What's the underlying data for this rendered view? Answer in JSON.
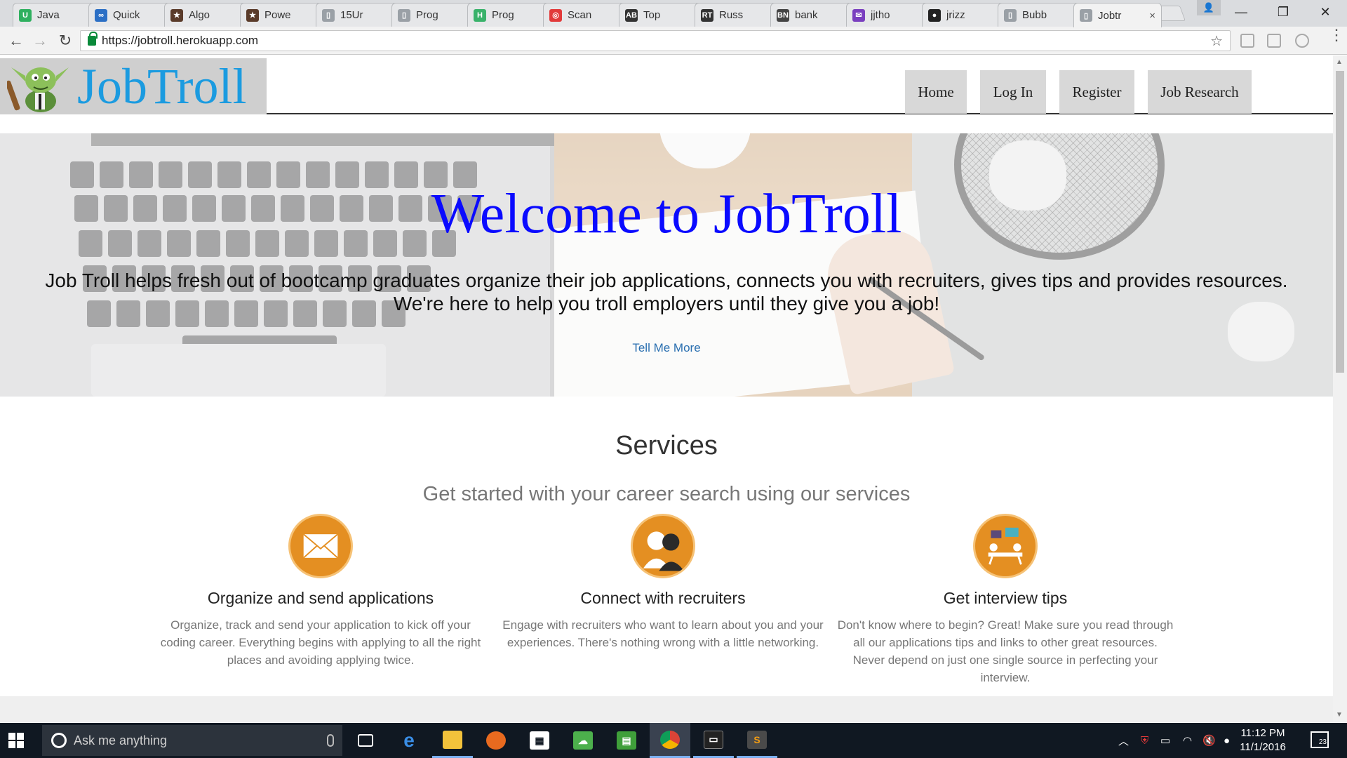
{
  "browser": {
    "tabs": [
      {
        "label": "Java",
        "favicon": "U",
        "color": "#2fb05f",
        "active": false
      },
      {
        "label": "Quick",
        "favicon": "∞",
        "color": "#2b6fc5",
        "active": false
      },
      {
        "label": "Algo",
        "favicon": "★",
        "color": "#5a3b2a",
        "active": false
      },
      {
        "label": "Powe",
        "favicon": "★",
        "color": "#5a3b2a",
        "active": false
      },
      {
        "label": "15Ur",
        "favicon": "▯",
        "color": "#9aa0a6",
        "active": false
      },
      {
        "label": "Prog",
        "favicon": "▯",
        "color": "#9aa0a6",
        "active": false
      },
      {
        "label": "Prog",
        "favicon": "H",
        "color": "#39b26a",
        "active": false
      },
      {
        "label": "Scan",
        "favicon": "◎",
        "color": "#e23a3a",
        "active": false
      },
      {
        "label": "Top",
        "favicon": "AB",
        "color": "#333333",
        "active": false
      },
      {
        "label": "Russ",
        "favicon": "RT",
        "color": "#333333",
        "active": false
      },
      {
        "label": "bank",
        "favicon": "BN",
        "color": "#444444",
        "active": false
      },
      {
        "label": "jjtho",
        "favicon": "✉",
        "color": "#7a3fbf",
        "active": false
      },
      {
        "label": "jrizz",
        "favicon": "●",
        "color": "#222222",
        "active": false
      },
      {
        "label": "Bubb",
        "favicon": "▯",
        "color": "#9aa0a6",
        "active": false
      },
      {
        "label": "Jobtr",
        "favicon": "▯",
        "color": "#9aa0a6",
        "active": true
      }
    ],
    "close_glyph": "×",
    "url": "https://jobtroll.herokuapp.com",
    "icons": {
      "back": "←",
      "forward": "→",
      "reload": "↻",
      "star": "☆",
      "menu": "⋮",
      "minimize": "—",
      "maximize": "❐",
      "close": "✕",
      "profile": "👤"
    }
  },
  "site": {
    "logo_text": "JobTroll",
    "nav": [
      "Home",
      "Log In",
      "Register",
      "Job Research"
    ],
    "hero": {
      "title": "Welcome to JobTroll",
      "text_line1": "Job Troll helps fresh out of bootcamp graduates organize their job applications, connects you with recruiters, gives tips and provides resources.",
      "text_line2": "We're here to help you troll employers until they give you a job!",
      "link": "Tell Me More"
    },
    "services": {
      "title": "Services",
      "subtitle": "Get started with your career search using our services",
      "items": [
        {
          "icon": "envelope-icon",
          "title": "Organize and send applications",
          "desc": "Organize, track and send your application to kick off your coding career. Everything begins with applying to all the right places and avoiding applying twice."
        },
        {
          "icon": "people-icon",
          "title": "Connect with recruiters",
          "desc": "Engage with recruiters who want to learn about you and your experiences. There's nothing wrong with a little networking."
        },
        {
          "icon": "interview-icon",
          "title": "Get interview tips",
          "desc": "Don't know where to begin? Great! Make sure you read through all our applications tips and links to other great resources. Never depend on just one single source in perfecting your interview."
        }
      ]
    },
    "colors": {
      "logo": "#1b9be0",
      "hero_title": "#0a0aff",
      "service_icon": "#e48f22",
      "link": "#2a6fb0"
    }
  },
  "taskbar": {
    "search_placeholder": "Ask me anything",
    "time": "11:12 PM",
    "date": "11/1/2016",
    "notification_count": "23",
    "apps": [
      "task-view",
      "edge",
      "file-explorer",
      "firefox",
      "store",
      "line",
      "evernote",
      "chrome",
      "cmd",
      "sublime-text"
    ]
  }
}
